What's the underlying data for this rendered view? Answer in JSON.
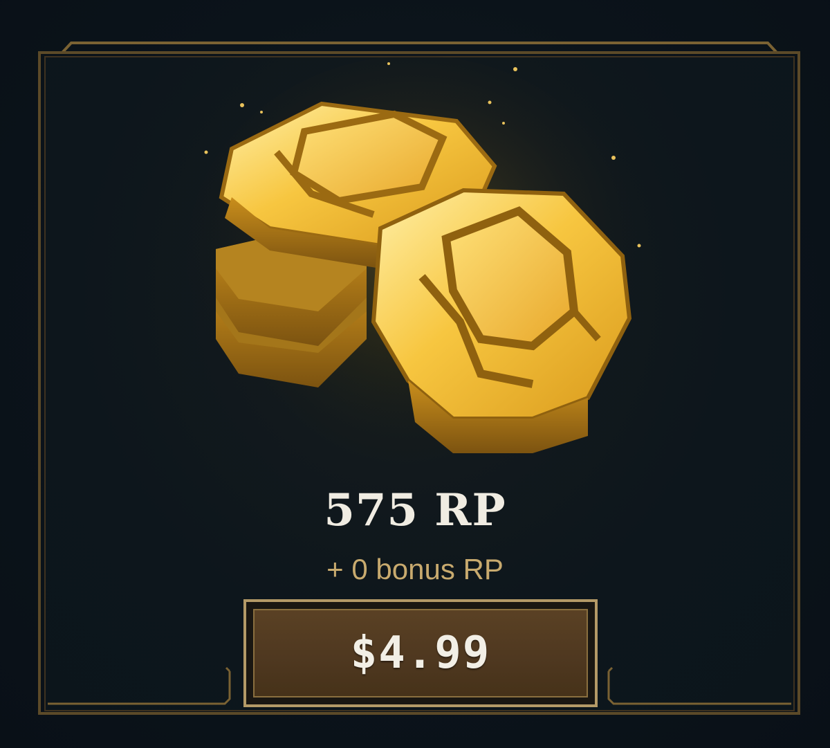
{
  "offer": {
    "amount_label": "575 RP",
    "bonus_label": "+ 0 bonus RP",
    "price_label": "$4.99",
    "icon": "riot-points-coins-icon"
  },
  "colors": {
    "background": "#0c151b",
    "frame_gold": "#7a6233",
    "amount_text": "#f0ece2",
    "bonus_text": "#c8aa6e",
    "button_fill": "#4f3820",
    "button_border": "#b49a67"
  }
}
